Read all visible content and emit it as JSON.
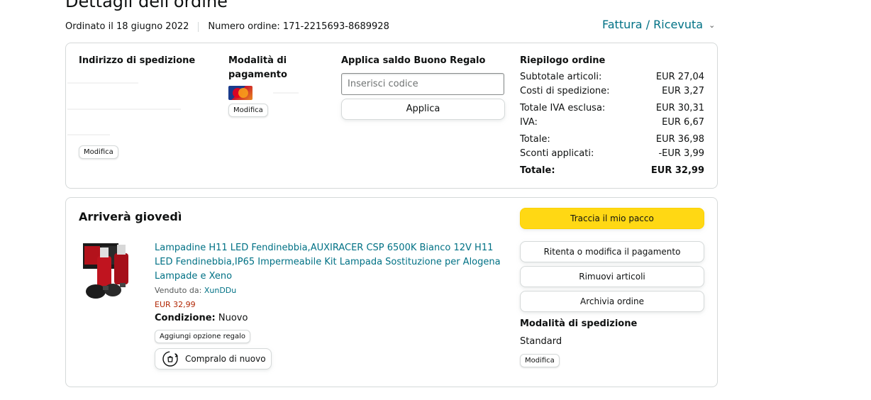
{
  "header": {
    "title": "Dettagli dell'ordine",
    "ordered_on": "Ordinato il 18 giugno 2022",
    "order_number": "Numero ordine: 171-2215693-8689928",
    "invoice_label": "Fattura / Ricevuta"
  },
  "summary_box": {
    "shipping_address": {
      "heading": "Indirizzo di spedizione",
      "edit_label": "Modifica"
    },
    "payment": {
      "heading_line1": "Modalità di",
      "heading_line2": "pagamento",
      "card_icon": "mastercard-icon",
      "edit_label": "Modifica"
    },
    "gift_card": {
      "heading": "Applica saldo Buono Regalo",
      "input_placeholder": "Inserisci codice",
      "input_value": "",
      "apply_label": "Applica"
    },
    "order_summary": {
      "heading": "Riepilogo ordine",
      "rows": [
        {
          "label": "Subtotale articoli:",
          "value": "EUR 27,04"
        },
        {
          "label": "Costi di spedizione:",
          "value": "EUR 3,27"
        },
        {
          "label": "Totale IVA esclusa:",
          "value": "EUR 30,31"
        },
        {
          "label": "IVA:",
          "value": "EUR 6,67"
        },
        {
          "label": "Totale:",
          "value": "EUR 36,98"
        },
        {
          "label": "Sconti applicati:",
          "value": "-EUR 3,99"
        },
        {
          "label": "Totale:",
          "value": "EUR 32,99"
        }
      ]
    }
  },
  "shipment_box": {
    "arrival_heading": "Arriverà giovedì",
    "product": {
      "title": "Lampadine H11 LED Fendinebbia,AUXIRACER CSP 6500K Bianco 12V H11 LED Fendinebbia,IP65 Impermeabile Kit Lampada Sostituzione per Alogena Lampade e Xeno",
      "sold_by_label": "Venduto da:",
      "seller": "XunDDu",
      "price": "EUR 32,99",
      "condition_label": "Condizione:",
      "condition_value": "Nuovo",
      "gift_option_label": "Aggiungi opzione regalo",
      "buy_again_label": "Compralo di nuovo"
    },
    "actions": {
      "track": "Traccia il mio pacco",
      "retry_payment": "Ritenta o modifica il pagamento",
      "remove_items": "Rimuovi articoli",
      "archive": "Archivia ordine"
    },
    "shipping_method": {
      "heading": "Modalità di spedizione",
      "value": "Standard",
      "edit_label": "Modifica"
    }
  },
  "colors": {
    "link": "#007185",
    "primary_button": "#ffd814",
    "price": "#b12704",
    "border": "#d5d9d9"
  }
}
